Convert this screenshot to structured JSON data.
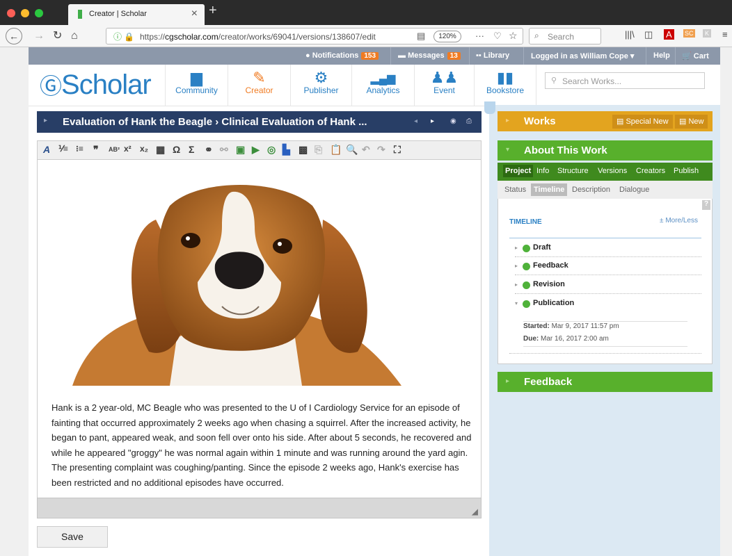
{
  "browser": {
    "tab_title": "Creator | Scholar",
    "new_tab": "+",
    "url_prefix": "https://",
    "url_domain": "cgscholar.com",
    "url_path": "/creator/works/69041/versions/138607/edit",
    "zoom": "120%",
    "search_placeholder": "Search"
  },
  "topstrip": {
    "notifications_label": "Notifications",
    "notifications_count": "153",
    "messages_label": "Messages",
    "messages_count": "13",
    "library_label": "Library",
    "logged_in": "Logged in as William Cope",
    "help": "Help",
    "cart": "Cart"
  },
  "header": {
    "logo_text": "Scholar",
    "nav": [
      {
        "label": "Community",
        "icon": "chat-icon",
        "color": "#2a80c4"
      },
      {
        "label": "Creator",
        "icon": "pencil-icon",
        "color": "#f07b22"
      },
      {
        "label": "Publisher",
        "icon": "gear-icon",
        "color": "#2a80c4"
      },
      {
        "label": "Analytics",
        "icon": "chart-icon",
        "color": "#2a80c4"
      },
      {
        "label": "Event",
        "icon": "people-icon",
        "color": "#2a80c4"
      },
      {
        "label": "Bookstore",
        "icon": "book-icon",
        "color": "#2a80c4"
      }
    ],
    "search_placeholder": "Search Works..."
  },
  "editor": {
    "title": "Evaluation of Hank the Beagle › Clinical Evaluation of Hank ...",
    "body": "Hank is a 2 year-old, MC Beagle who was presented to the U of I Cardiology Service for an episode of fainting that occurred approximately 2 weeks ago when chasing a squirrel. After the increased activity, he began to pant, appeared weak, and soon fell over onto his side. After about 5 seconds, he recovered and while he appeared \"groggy\" he was normal again within 1 minute and was running around the yard agin. The presenting complaint was coughing/panting. Since the episode 2 weeks ago, Hank's exercise has been restricted and no additional episodes have occurred.",
    "save_label": "Save",
    "image_alt": "beagle-photo"
  },
  "works": {
    "title": "Works",
    "special_new": "Special New",
    "new": "New"
  },
  "about": {
    "title": "About This Work",
    "tabs": [
      "Project",
      "Info",
      "Structure",
      "Versions",
      "Creators",
      "Publish"
    ],
    "subtabs": [
      "Status",
      "Timeline",
      "Description",
      "Dialogue"
    ],
    "help": "?",
    "timeline_title": "TIMELINE",
    "more_less": "± More/Less",
    "stages": [
      "Draft",
      "Feedback",
      "Revision",
      "Publication"
    ],
    "started_label": "Started:",
    "started_value": "Mar 9, 2017 11:57 pm",
    "due_label": "Due:",
    "due_value": "Mar 16, 2017 2:00 am"
  },
  "feedback": {
    "title": "Feedback"
  },
  "colors": {
    "brand_blue": "#2a80c4",
    "works_yellow": "#e3a41f",
    "green": "#58b02c",
    "editor_header": "#283e66"
  }
}
